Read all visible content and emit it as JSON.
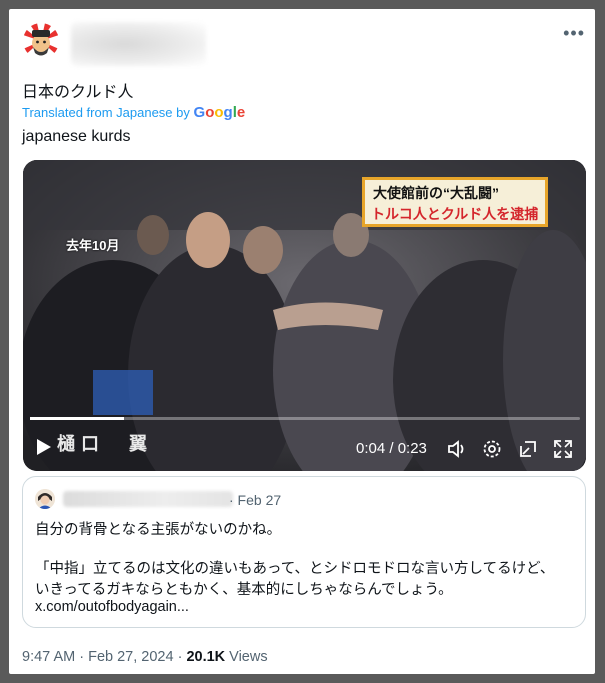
{
  "post": {
    "more_icon": "more-horizontal-icon",
    "original_text": "日本のクルド人",
    "translated_prefix": "Translated from Japanese by",
    "translated_by": "Google",
    "translated_text": "japanese kurds"
  },
  "video": {
    "banner_line1": "大使館前の“大乱闘”",
    "banner_line2": "トルコ人とクルド人を逮捕",
    "date_overlay": "去年10月",
    "caption": "樋口　翼",
    "timecode": "0:04 / 0:23",
    "progress": 0.17,
    "controls": [
      "play-icon",
      "volume-icon",
      "settings-icon",
      "popout-icon",
      "fullscreen-icon"
    ]
  },
  "quote": {
    "dot_date": "· Feb 27",
    "line1": "自分の背骨となる主張がないのかね。",
    "line2": "「中指」立てるのは文化の違いもあって、とシドロモドロな言い方してるけど、",
    "line3": "いきってるガキならともかく、基本的にしちゃならんでしょう。",
    "link": "x.com/outofbodyagain..."
  },
  "footer": {
    "timestamp": "9:47 AM · Feb 27, 2024 · ",
    "views_count": "20.1K",
    "views_label": " Views"
  }
}
